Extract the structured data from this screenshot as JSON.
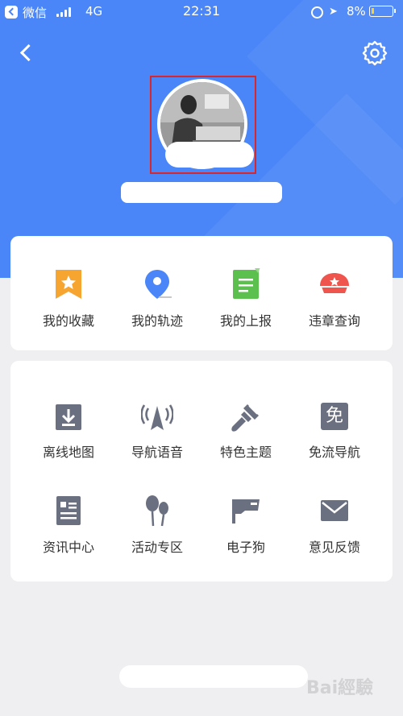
{
  "status_bar": {
    "app": "微信",
    "network": "4G",
    "time": "22:31",
    "battery": "8%"
  },
  "header": {
    "back_icon": "chevron-left-icon",
    "settings_icon": "gear-icon"
  },
  "quick_items": [
    {
      "label": "我的收藏",
      "icon": "bookmark-star-icon",
      "color": "#f7a531"
    },
    {
      "label": "我的轨迹",
      "icon": "map-pin-icon",
      "color": "#4a86f7"
    },
    {
      "label": "我的上报",
      "icon": "report-note-icon",
      "color": "#5cc04e"
    },
    {
      "label": "违章查询",
      "icon": "police-cap-icon",
      "color": "#f0554d"
    }
  ],
  "tools": [
    {
      "label": "离线地图",
      "icon": "download-icon"
    },
    {
      "label": "导航语音",
      "icon": "navigation-broadcast-icon"
    },
    {
      "label": "特色主题",
      "icon": "paint-brush-icon"
    },
    {
      "label": "免流导航",
      "icon": "free-data-icon",
      "glyph": "免"
    },
    {
      "label": "资讯中心",
      "icon": "news-icon"
    },
    {
      "label": "活动专区",
      "icon": "balloons-icon"
    },
    {
      "label": "电子狗",
      "icon": "speed-camera-icon"
    },
    {
      "label": "意见反馈",
      "icon": "envelope-icon"
    }
  ],
  "watermark": "Bai經驗",
  "colors": {
    "header": "#4a86f7",
    "icon_gray": "#6b7080",
    "highlight": "#d9262c"
  }
}
